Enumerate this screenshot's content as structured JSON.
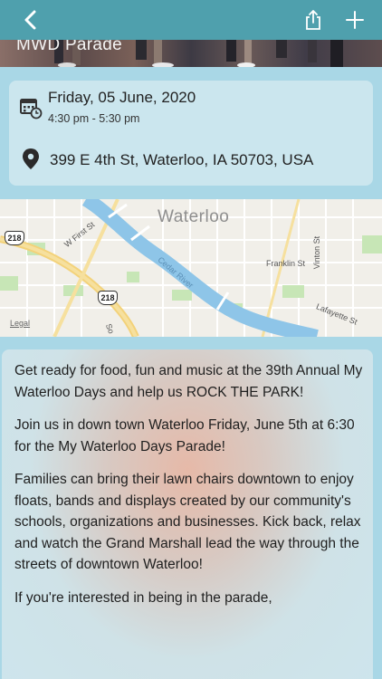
{
  "nav": {
    "back_icon": "chevron-left-icon",
    "share_icon": "share-icon",
    "add_icon": "plus-icon"
  },
  "hero": {
    "title": "MWD Parade"
  },
  "event": {
    "date": "Friday, 05 June, 2020",
    "time": "4:30 pm - 5:30 pm",
    "address": "399 E 4th St,  Waterloo, IA 50703, USA",
    "date_icon": "calendar-clock-icon",
    "location_icon": "map-pin-icon"
  },
  "map": {
    "city": "Waterloo",
    "streets": {
      "w_first": "W First St",
      "franklin": "Franklin St",
      "vinton": "Vinton St",
      "lafayette": "Lafayette St",
      "cedar_river": "Cedar River",
      "south": "So"
    },
    "shields": {
      "a": "218",
      "b": "218"
    },
    "legal": "Legal"
  },
  "description": {
    "paragraphs": [
      "Get ready for food, fun and music at the 39th Annual My Waterloo Days and help us ROCK THE PARK!",
      "Join us in down town Waterloo Friday, June 5th at 6:30 for the My Waterloo Days Parade!",
      "Families can bring their lawn chairs downtown to enjoy floats, bands and displays created by our community's schools, organizations and businesses.  Kick back, relax and watch the Grand Marshall lead the way through the streets of downtown Waterloo!",
      "If you're interested in being in the parade,"
    ]
  },
  "colors": {
    "navbar": "#4fa0ad",
    "background": "#a9d7e6",
    "card": "#cbe6ee",
    "river": "#8ec5e8"
  }
}
